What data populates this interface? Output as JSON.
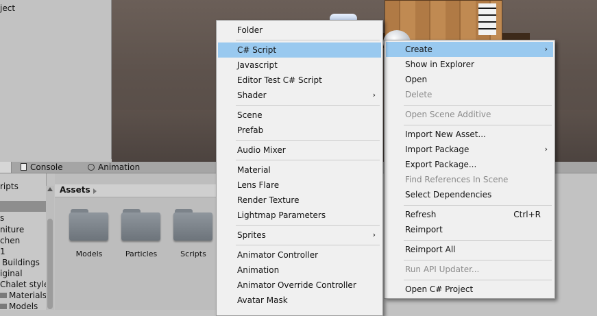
{
  "hierarchy": {
    "item": "ject"
  },
  "tabs": {
    "console": "Console",
    "animation": "Animation"
  },
  "tree": {
    "items": [
      "ripts",
      "",
      "s",
      "niture",
      "chen",
      "1",
      "Buildings",
      "iginal",
      "Chalet style",
      "Materials",
      "Models"
    ]
  },
  "assets": {
    "breadcrumb": "Assets",
    "folders": [
      "Models",
      "Particles",
      "Scripts"
    ]
  },
  "menu_main": {
    "items": [
      {
        "label": "Create",
        "submenu": "›"
      },
      {
        "label": "Show in Explorer"
      },
      {
        "label": "Open"
      },
      {
        "label": "Delete"
      },
      {
        "label": "Open Scene Additive"
      },
      {
        "label": "Import New Asset..."
      },
      {
        "label": "Import Package",
        "submenu": "›"
      },
      {
        "label": "Export Package..."
      },
      {
        "label": "Find References In Scene"
      },
      {
        "label": "Select Dependencies"
      },
      {
        "label": "Refresh",
        "shortcut": "Ctrl+R"
      },
      {
        "label": "Reimport"
      },
      {
        "label": "Reimport All"
      },
      {
        "label": "Run API Updater..."
      },
      {
        "label": "Open C# Project"
      }
    ]
  },
  "menu_sub": {
    "items": [
      {
        "label": "Folder"
      },
      {
        "label": "C# Script"
      },
      {
        "label": "Javascript"
      },
      {
        "label": "Editor Test C# Script"
      },
      {
        "label": "Shader",
        "submenu": "›"
      },
      {
        "label": "Scene"
      },
      {
        "label": "Prefab"
      },
      {
        "label": "Audio Mixer"
      },
      {
        "label": "Material"
      },
      {
        "label": "Lens Flare"
      },
      {
        "label": "Render Texture"
      },
      {
        "label": "Lightmap Parameters"
      },
      {
        "label": "Sprites",
        "submenu": "›"
      },
      {
        "label": "Animator Controller"
      },
      {
        "label": "Animation"
      },
      {
        "label": "Animator Override Controller"
      },
      {
        "label": "Avatar Mask"
      }
    ]
  },
  "colors": {
    "highlight": "#99c9ef",
    "menu_bg": "#f0f0f0",
    "disabled_text": "#8a8a8a"
  }
}
